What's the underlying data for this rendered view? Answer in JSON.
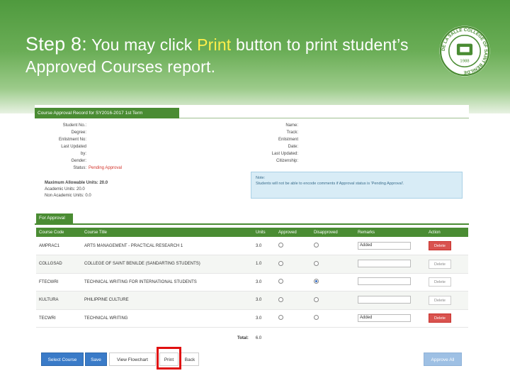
{
  "slide": {
    "step_label": "Step 8:",
    "text_before": " You may click ",
    "highlight_word": "Print",
    "text_after": " button to print student’s Approved Courses report."
  },
  "logo": {
    "ring_text": "DE LA SALLE COLLEGE OF SAINT BENILDE",
    "year": "1988",
    "color": "#4a8c33"
  },
  "screen": {
    "title": "Course Approval Record for SY2016-2017 1st Term",
    "left_info": [
      {
        "label": "Student No.:",
        "value": ""
      },
      {
        "label": "Degree:",
        "value": ""
      },
      {
        "label": "Enlistment No:",
        "value": ""
      },
      {
        "label": "Last Updated",
        "value": ""
      },
      {
        "label": "by:",
        "value": ""
      },
      {
        "label": "Gender:",
        "value": ""
      },
      {
        "label": "Status:",
        "value": "Pending Approval"
      }
    ],
    "right_info": [
      {
        "label": "Name:"
      },
      {
        "label": "Track:"
      },
      {
        "label": "Enlistment"
      },
      {
        "label": "Date:"
      },
      {
        "label": "Last Updated:"
      },
      {
        "label": "Citizenship:"
      }
    ],
    "units": {
      "max": "Maximum Allowable Units: 20.0",
      "academic": "Academic Units: 20.0",
      "non_academic": "Non Academic Units: 0.0"
    },
    "note": {
      "label": "Note:",
      "text": "Students will not be able to encode comments if Approval status is 'Pending Approval'."
    },
    "tab": "For Approval",
    "table": {
      "headers": [
        "Course Code",
        "Course Title",
        "Units",
        "Approved",
        "Disapproved",
        "Remarks",
        "Action"
      ],
      "rows": [
        {
          "code": "AMPRAC1",
          "title": "ARTS MANAGEMENT - PRACTICAL RESEARCH 1",
          "units": "3.0",
          "approved": false,
          "disapproved": false,
          "remark": "Added",
          "action": "Delete",
          "action_active": true
        },
        {
          "code": "COLLGSAD",
          "title": "COLLEGE OF SAINT BENILDE (SANDARTING STUDENTS)",
          "units": "1.0",
          "approved": false,
          "disapproved": false,
          "remark": "",
          "action": "Delete",
          "action_active": false
        },
        {
          "code": "FTECWRI",
          "title": "TECHNICAL WRITING FOR INTERNATIONAL STUDENTS",
          "units": "3.0",
          "approved": false,
          "disapproved": true,
          "remark": "",
          "action": "Delete",
          "action_active": false
        },
        {
          "code": "KULTURA",
          "title": "PHILIPPINE CULTURE",
          "units": "3.0",
          "approved": false,
          "disapproved": false,
          "remark": "",
          "action": "Delete",
          "action_active": false
        },
        {
          "code": "TECWRI",
          "title": "TECHNICAL WRITING",
          "units": "3.0",
          "approved": false,
          "disapproved": false,
          "remark": "Added",
          "action": "Delete",
          "action_active": true
        }
      ],
      "total_label": "Total:",
      "total_value": "6.0"
    },
    "buttons": {
      "select_course": "Select Course",
      "save": "Save",
      "view_flowchart": "View Flowchart",
      "print": "Print",
      "back": "Back",
      "approve_all": "Approve All"
    },
    "colors": {
      "green": "#4a8c33",
      "blue": "#3a7bc8",
      "red": "#d9534f",
      "highlight": "#e01010"
    }
  }
}
